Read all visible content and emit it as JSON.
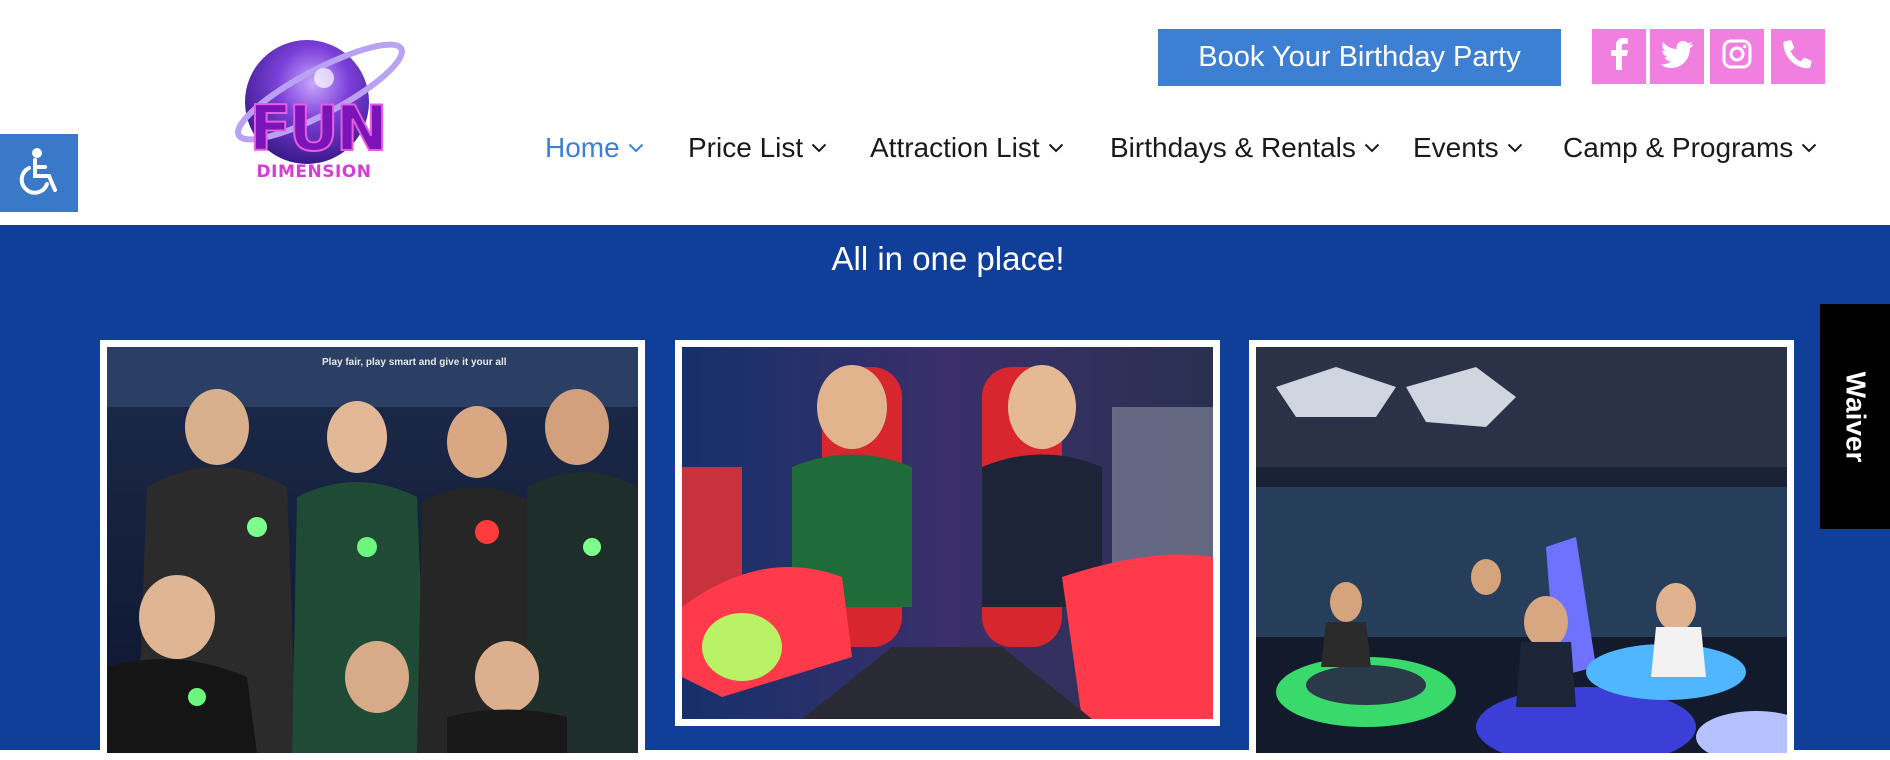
{
  "header": {
    "logo": {
      "main": "FUN",
      "sub": "DIMENSION"
    },
    "book_button": "Book Your Birthday Party",
    "social": [
      {
        "name": "facebook-icon"
      },
      {
        "name": "twitter-icon"
      },
      {
        "name": "instagram-icon"
      },
      {
        "name": "phone-icon"
      }
    ],
    "accessibility_icon": "wheelchair-icon"
  },
  "nav": {
    "items": [
      {
        "label": "Home",
        "active": true
      },
      {
        "label": "Price List"
      },
      {
        "label": "Attraction List"
      },
      {
        "label": "Birthdays & Rentals"
      },
      {
        "label": "Events"
      },
      {
        "label": "Camp & Programs"
      }
    ]
  },
  "hero": {
    "tagline": "All in one place!",
    "photos": [
      {
        "name": "laser-tag-photo",
        "caption": "Play fair, play smart and give it your all"
      },
      {
        "name": "arcade-game-photo"
      },
      {
        "name": "bumper-cars-photo"
      }
    ]
  },
  "waiver": {
    "label": "Waiver"
  },
  "colors": {
    "accent": "#3d7fd2",
    "social_pink": "#f07fe0",
    "hero_blue": "#103f99"
  }
}
